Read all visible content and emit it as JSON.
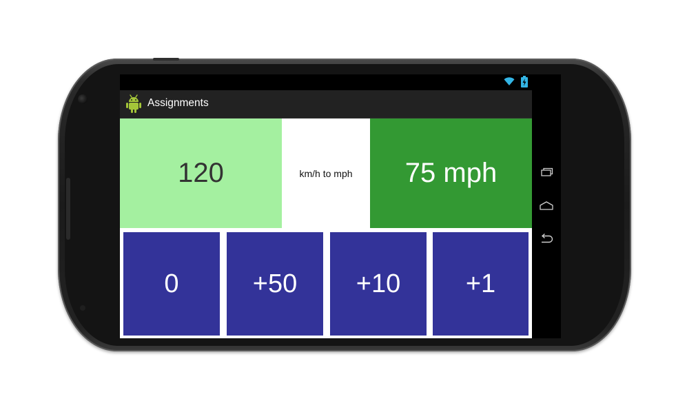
{
  "colors": {
    "input_panel_bg": "#a4f0a0",
    "output_panel_bg": "#339933",
    "button_bg": "#333399",
    "actionbar_bg": "#222222",
    "status_icon_color": "#33b5e5"
  },
  "device": {
    "status_icons": [
      "wifi-icon",
      "battery-charging-icon"
    ],
    "nav_icons": [
      "recent-apps-icon",
      "home-icon",
      "back-icon"
    ]
  },
  "app": {
    "icon": "android-icon",
    "title": "Assignments"
  },
  "converter": {
    "input_value": "120",
    "label": "km/h to mph",
    "output_value": "75 mph"
  },
  "buttons": [
    {
      "label": "0"
    },
    {
      "label": "+50"
    },
    {
      "label": "+10"
    },
    {
      "label": "+1"
    }
  ]
}
